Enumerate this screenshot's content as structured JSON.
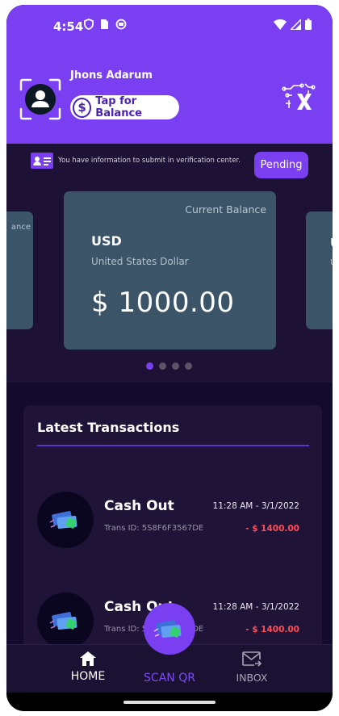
{
  "status_bar": {
    "time": "4:54"
  },
  "header": {
    "user_name": "Jhons Adarum",
    "balance_button": "Tap for Balance",
    "balance_symbol": "$"
  },
  "notice": {
    "text": "You have information to submit in verification center.",
    "status_button": "Pending"
  },
  "cards": {
    "left_label": "ance",
    "main": {
      "label": "Current Balance",
      "code": "USD",
      "name": "United States Dollar",
      "amount": "$ 1000.00"
    },
    "right_code": "U",
    "right_name": "U"
  },
  "carousel": {
    "count": 4,
    "active_index": 0
  },
  "transactions": {
    "title": "Latest Transactions",
    "items": [
      {
        "type": "Cash Out",
        "date": "11:28 AM - 3/1/2022",
        "trans_id": "Trans ID: 5S8F6F3567DE",
        "amount": "- $ 1400.00"
      },
      {
        "type": "Cash Out",
        "date": "11:28 AM - 3/1/2022",
        "trans_id": "Trans ID: 5S8F6F3567DE",
        "amount": "- $ 1400.00"
      }
    ]
  },
  "nav": {
    "home": "HOME",
    "scan": "SCAN QR",
    "inbox": "INBOX"
  },
  "colors": {
    "primary": "#7b3ff2",
    "background": "#140a2c",
    "card": "#3c5467",
    "negative": "#ff4d55"
  }
}
